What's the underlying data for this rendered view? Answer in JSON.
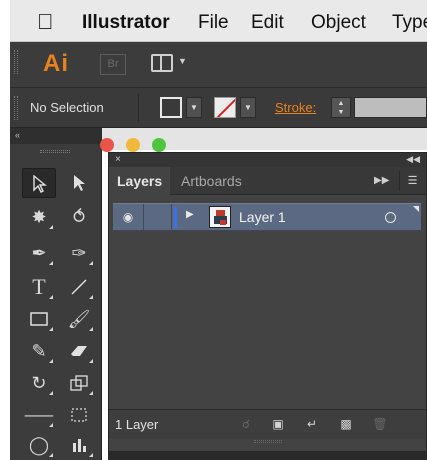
{
  "menubar": {
    "items": [
      "Illustrator",
      "File",
      "Edit",
      "Object",
      "Type"
    ]
  },
  "appbar": {
    "app_logo": "Ai",
    "bridge_label": "Br"
  },
  "controlbar": {
    "selection_status": "No Selection",
    "stroke_label": "Stroke:"
  },
  "layers_panel": {
    "tabs": [
      "Layers",
      "Artboards"
    ],
    "layers": [
      {
        "name": "Layer 1",
        "visible": true,
        "color": "#3a6ff0"
      }
    ],
    "footer_count": "1 Layer"
  },
  "colors": {
    "accent": "#e8821d",
    "selected_row": "#5b6a82",
    "panel_bg": "#434343"
  }
}
